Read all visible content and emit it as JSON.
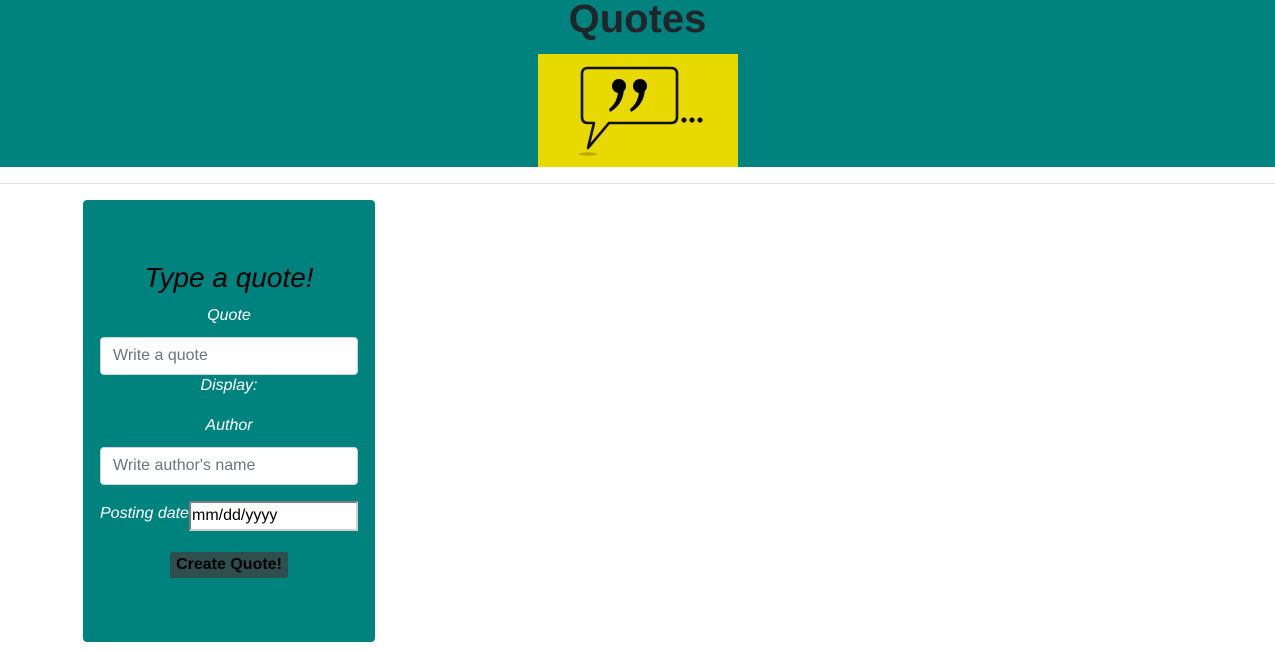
{
  "header": {
    "title": "Quotes",
    "logo_icon": "quote-speech-bubble-icon",
    "background_color": "#00837f",
    "logo_background_color": "#e8d900"
  },
  "form": {
    "title": "Type a quote!",
    "quote_label": "Quote",
    "quote_placeholder": "Write a quote",
    "display_label": "Display:",
    "author_label": "Author",
    "author_placeholder": "Write author's name",
    "date_label": "Posting date",
    "date_value": "mm/dd/yyyy",
    "submit_label": "Create Quote!",
    "card_color": "#00837f",
    "button_color": "#2f4f4f"
  }
}
